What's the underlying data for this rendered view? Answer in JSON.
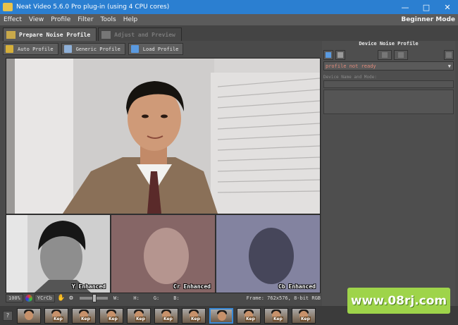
{
  "window": {
    "title": "Neat Video 5.6.0 Pro plug-in (using 4 CPU cores)"
  },
  "menu": {
    "items": [
      "Effect",
      "View",
      "Profile",
      "Filter",
      "Tools",
      "Help"
    ],
    "mode": "Beginner Mode"
  },
  "tabs": [
    {
      "label": "Prepare Noise Profile",
      "active": true
    },
    {
      "label": "Adjust and Preview",
      "active": false
    }
  ],
  "toolbar": {
    "auto_profile": "Auto Profile",
    "generic_profile": "Generic Profile",
    "load_profile": "Load Profile"
  },
  "viewer": {
    "channels": [
      "Y Enhanced",
      "Cr Enhanced",
      "Cb Enhanced"
    ]
  },
  "status": {
    "zoom": "100%",
    "colorspace": "YCrCb",
    "w_label": "W:",
    "h_label": "H:",
    "g_label": "G:",
    "b_label": "B:",
    "frame_info": "Frame: 762x576, 8-bit RGB"
  },
  "panel": {
    "title": "Device Noise Profile",
    "profile_status": "profile not ready",
    "device_label": "Device Name and Mode:"
  },
  "filmstrip": {
    "help": "?",
    "frames": [
      "",
      "Kep",
      "Kep",
      "Kep",
      "Kep",
      "Kep",
      "Kep",
      "",
      "Kep",
      "Kep",
      "Kep"
    ],
    "selected_index": 7
  },
  "watermark": {
    "text": "www.08rj.com"
  },
  "colors": {
    "titlebar": "#2b7fd1",
    "status_warning": "#e08a7a",
    "selection": "#3a8ad8",
    "watermark_bg": "#9ed44a"
  }
}
